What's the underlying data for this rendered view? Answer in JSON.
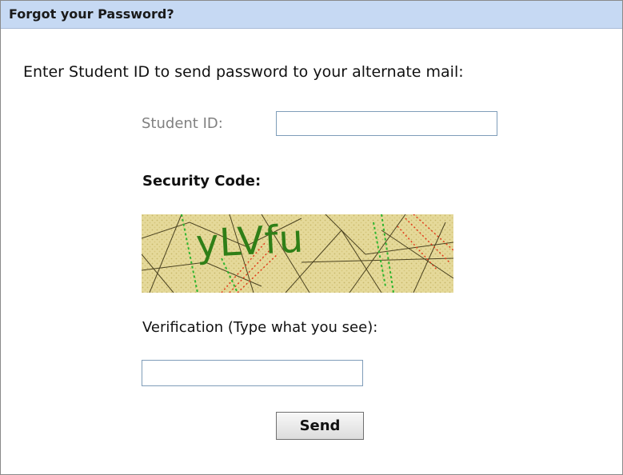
{
  "header": {
    "title": "Forgot your Password?"
  },
  "form": {
    "intro_text": "Enter Student ID to send password to your alternate mail:",
    "student_id_label": "Student ID:",
    "student_id_value": "",
    "security_code_label": "Security Code:",
    "captcha_text": "yLVfu",
    "verification_label": "Verification (Type what you see):",
    "verification_value": "",
    "send_label": "Send"
  },
  "colors": {
    "header_background": "#c6d9f3",
    "captcha_background": "#e5d99a",
    "captcha_text": "#2f7f17",
    "input_border": "#7f9db9"
  }
}
